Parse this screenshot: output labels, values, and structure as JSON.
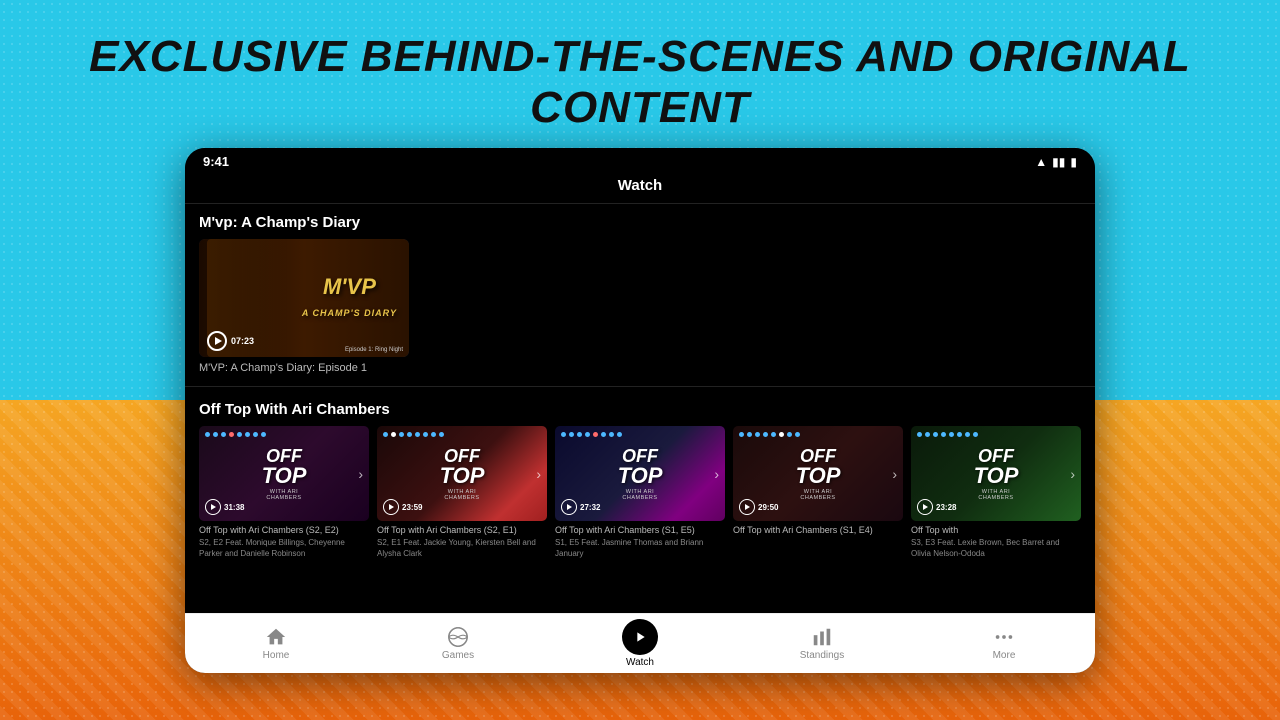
{
  "page": {
    "headline": "EXCLUSIVE BEHIND-THE-SCENES AND ORIGINAL CONTENT"
  },
  "status_bar": {
    "time": "9:41",
    "wifi": "▲",
    "signal": "▮▮▮"
  },
  "app_header": {
    "title": "Watch"
  },
  "section1": {
    "title": "M'vp: A Champ's Diary",
    "featured_caption": "M'VP: A Champ's Diary: Episode 1",
    "duration": "07:23"
  },
  "section2": {
    "title": "Off Top With Ari Chambers",
    "videos": [
      {
        "duration": "31:38",
        "caption": "Off Top with Ari Chambers (S2, E2)",
        "sub": "S2, E2 Feat. Monique Billings, Cheyenne Parker and Danielle Robinson"
      },
      {
        "duration": "23:59",
        "caption": "Off Top with Ari Chambers (S2, E1)",
        "sub": "S2, E1 Feat. Jackie Young, Kiersten Bell and Alysha Clark"
      },
      {
        "duration": "27:32",
        "caption": "Off Top with Ari Chambers (S1, E5)",
        "sub": "S1, E5 Feat. Jasmine Thomas and Briann January"
      },
      {
        "duration": "29:50",
        "caption": "Off Top with Ari Chambers (S1, E4)",
        "sub": ""
      },
      {
        "duration": "23:28",
        "caption": "Off Top with",
        "sub": "S3, E3 Feat. Lexie Brown, Bec Barret and Olivia Nelson-Ododa"
      }
    ]
  },
  "nav": {
    "items": [
      {
        "label": "Home",
        "icon": "home"
      },
      {
        "label": "Games",
        "icon": "basketball"
      },
      {
        "label": "Watch",
        "icon": "play",
        "active": true
      },
      {
        "label": "Standings",
        "icon": "standings"
      },
      {
        "label": "More",
        "icon": "more"
      }
    ]
  },
  "dot_colors": {
    "card1": [
      "#4db8ff",
      "#4db8ff",
      "#4db8ff",
      "#ff6b6b",
      "#4db8ff",
      "#4db8ff",
      "#4db8ff",
      "#4db8ff"
    ],
    "card2": [
      "#4db8ff",
      "#fff",
      "#4db8ff",
      "#4db8ff",
      "#4db8ff",
      "#4db8ff",
      "#4db8ff",
      "#4db8ff"
    ],
    "card3": [
      "#4db8ff",
      "#4db8ff",
      "#4db8ff",
      "#4db8ff",
      "#ff6b6b",
      "#4db8ff",
      "#4db8ff",
      "#4db8ff"
    ],
    "card4": [
      "#4db8ff",
      "#4db8ff",
      "#4db8ff",
      "#4db8ff",
      "#4db8ff",
      "#fff",
      "#4db8ff",
      "#4db8ff"
    ],
    "card5": [
      "#4db8ff",
      "#4db8ff",
      "#4db8ff",
      "#4db8ff",
      "#4db8ff",
      "#4db8ff",
      "#4db8ff",
      "#4db8ff"
    ]
  }
}
